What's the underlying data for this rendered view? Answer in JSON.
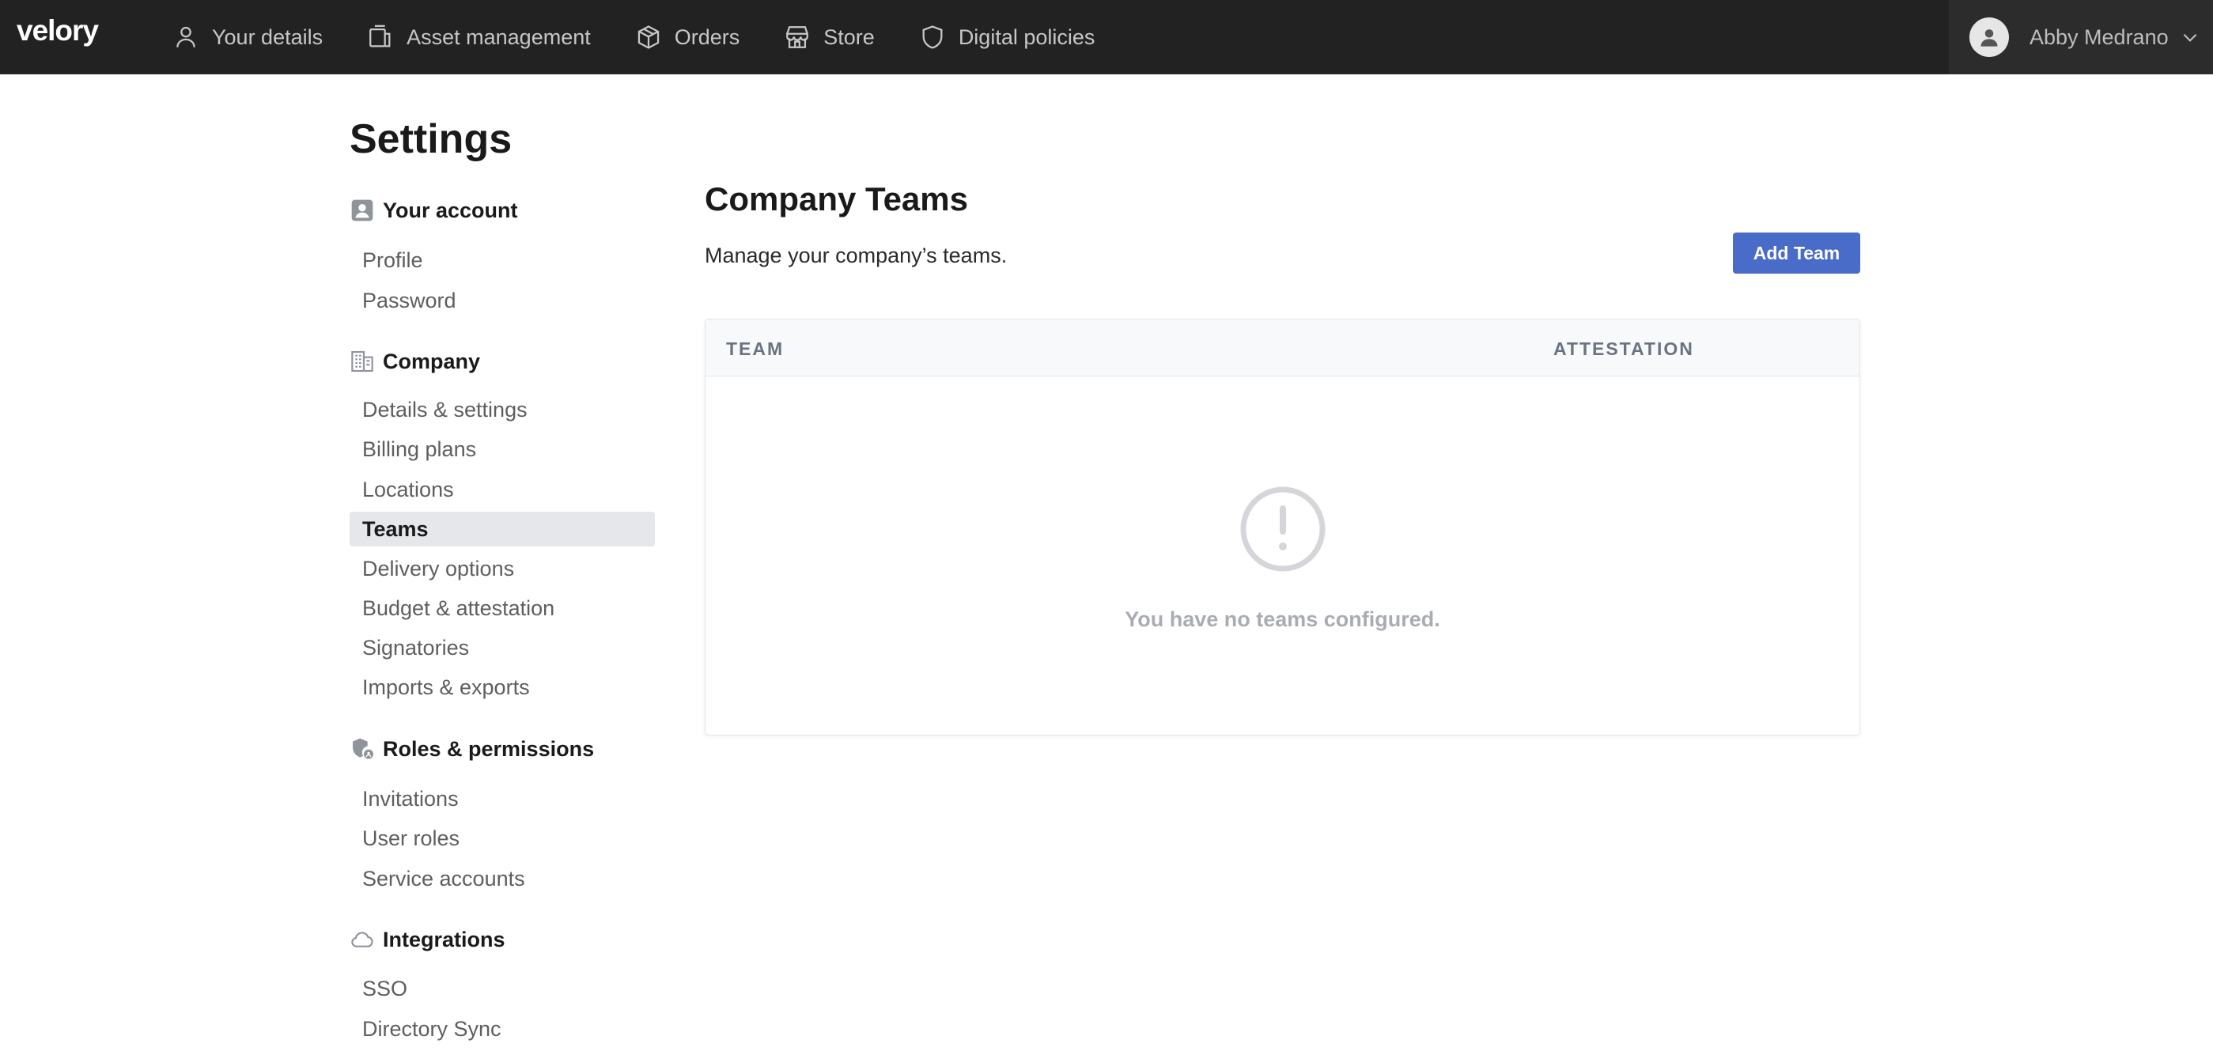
{
  "brand": {
    "logo": "velory"
  },
  "nav": {
    "items": [
      {
        "label": "Your details",
        "icon": "person-icon"
      },
      {
        "label": "Asset management",
        "icon": "asset-icon"
      },
      {
        "label": "Orders",
        "icon": "box-icon"
      },
      {
        "label": "Store",
        "icon": "store-icon"
      },
      {
        "label": "Digital policies",
        "icon": "shield-icon"
      }
    ],
    "user": {
      "name": "Abby Medrano"
    }
  },
  "page": {
    "title": "Settings"
  },
  "sidebar": {
    "sections": [
      {
        "title": "Your account",
        "icon": "account-icon",
        "links": [
          "Profile",
          "Password"
        ]
      },
      {
        "title": "Company",
        "icon": "building-icon",
        "links": [
          "Details & settings",
          "Billing plans",
          "Locations",
          "Teams",
          "Delivery options",
          "Budget & attestation",
          "Signatories",
          "Imports & exports"
        ]
      },
      {
        "title": "Roles & permissions",
        "icon": "shield-lock-icon",
        "links": [
          "Invitations",
          "User roles",
          "Service accounts"
        ]
      },
      {
        "title": "Integrations",
        "icon": "cloud-icon",
        "links": [
          "SSO",
          "Directory Sync"
        ]
      }
    ],
    "active": "Teams"
  },
  "main": {
    "title": "Company Teams",
    "subtitle": "Manage your company’s teams.",
    "add_button": "Add Team",
    "table": {
      "columns": [
        "TEAM",
        "ATTESTATION"
      ],
      "empty_message": "You have no teams configured."
    }
  },
  "colors": {
    "topbar": "#222222",
    "accent": "#4a6cc9",
    "active_bg": "#e5e7eb"
  }
}
